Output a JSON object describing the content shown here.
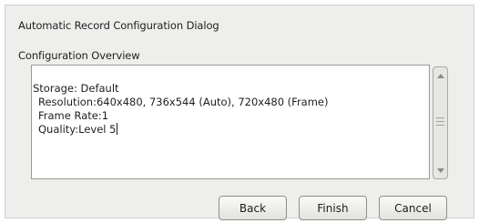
{
  "dialog": {
    "title": "Automatic Record Configuration Dialog",
    "section_label": "Configuration Overview"
  },
  "overview": {
    "lines": [
      "Storage: Default",
      "Resolution:640x480, 736x544 (Auto), 720x480 (Frame)",
      "Frame Rate:1",
      "Quality:Level 5"
    ]
  },
  "scrollbar": {
    "up_icon": "arrow-up-icon",
    "down_icon": "arrow-down-icon",
    "grip_icon": "grip-icon"
  },
  "buttons": {
    "back_label": "Back",
    "finish_label": "Finish",
    "cancel_label": "Cancel"
  }
}
